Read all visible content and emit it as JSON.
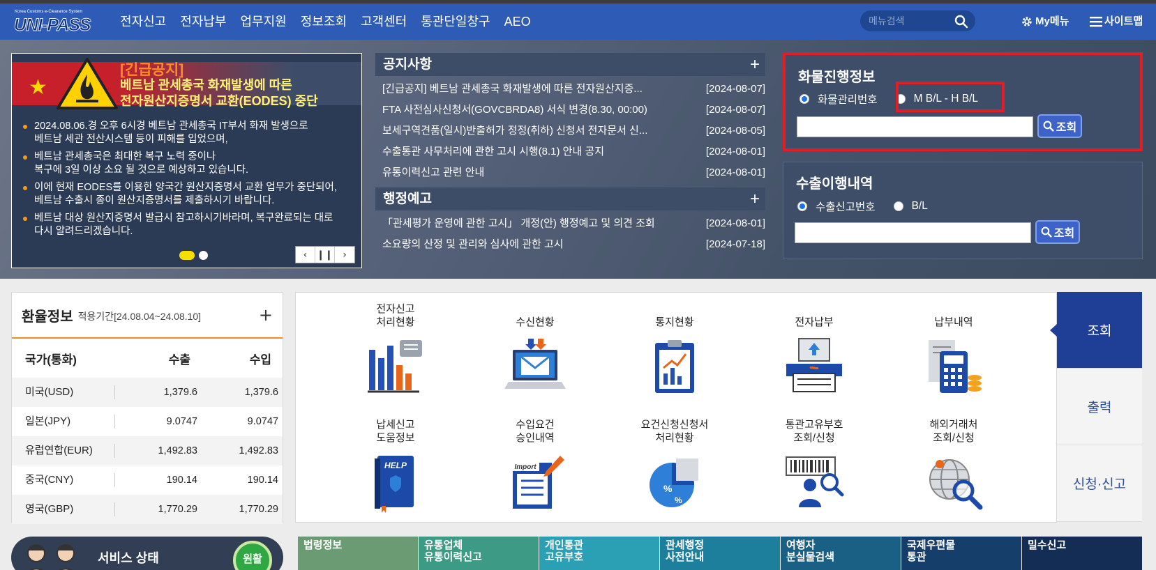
{
  "header": {
    "logo_sub": "Korea Customs e-Clearance System",
    "logo_text": "UNI-PASS",
    "nav": [
      "전자신고",
      "전자납부",
      "업무지원",
      "정보조회",
      "고객센터",
      "통관단일창구",
      "AEO"
    ],
    "search_placeholder": "메뉴검색",
    "my_menu": "My메뉴",
    "sitemap": "사이트맵"
  },
  "banner": {
    "title1": "[긴급공지]",
    "title2_line1": "베트남 관세총국 화재발생에 따른",
    "title2_line2": "전자원산지증명서 교환(EODES) 중단",
    "items": [
      "2024.08.06.경 오후 6시경 베트남 관세총국 IT부서 화재 발생으로\n베트남 세관 전산시스템 등이 피해를 입었으며,",
      "베트남 관세총국은 최대한 복구 노력 중이나\n복구에 3일 이상 소요 될 것으로 예상하고 있습니다.",
      "이에 현재 EODES를 이용한 양국간 원산지증명서 교환 업무가 중단되어,\n베트남 수출시 종이 원산지증명서를 제출하시기 바랍니다.",
      "베트남 대상 원산지증명서 발급시 참고하시기바라며, 복구완료되는 대로\n다시 알려드리겠습니다."
    ]
  },
  "notices": {
    "title": "공지사항",
    "items": [
      {
        "title": "[긴급공지] 베트남 관세총국 화재발생에 따른 전자원산지증...",
        "date": "[2024-08-07]"
      },
      {
        "title": "FTA 사전심사신청서(GOVCBRDA8) 서식 변경(8.30, 00:00)",
        "date": "[2024-08-07]"
      },
      {
        "title": "보세구역견품(일시)반출허가 정정(취하) 신청서 전자문서 신...",
        "date": "[2024-08-05]"
      },
      {
        "title": "수출통관 사무처리에 관한 고시 시행(8.1) 안내 공지",
        "date": "[2024-08-01]"
      },
      {
        "title": "유통이력신고 관련 안내",
        "date": "[2024-08-01]"
      }
    ]
  },
  "admin": {
    "title": "행정예고",
    "items": [
      {
        "title": "「관세평가 운영에 관한 고시」 개정(안) 행정예고 및 의견 조회",
        "date": "[2024-08-01]"
      },
      {
        "title": "소요량의 산정 및 관리와 심사에 관한 고시",
        "date": "[2024-07-18]"
      }
    ]
  },
  "cargo": {
    "title": "화물진행정보",
    "opt1": "화물관리번호",
    "opt2": "M B/L - H B/L",
    "btn": "조회"
  },
  "export": {
    "title": "수출이행내역",
    "opt1": "수출신고번호",
    "opt2": "B/L",
    "btn": "조회"
  },
  "rate": {
    "title": "환율정보",
    "period": "적용기간[24.08.04~24.08.10]",
    "cols": [
      "국가(통화)",
      "수출",
      "수입"
    ],
    "rows": [
      [
        "미국(USD)",
        "1,379.6",
        "1,379.6"
      ],
      [
        "일본(JPY)",
        "9.0747",
        "9.0747"
      ],
      [
        "유럽연합(EUR)",
        "1,492.83",
        "1,492.83"
      ],
      [
        "중국(CNY)",
        "190.14",
        "190.14"
      ],
      [
        "영국(GBP)",
        "1,770.29",
        "1,770.29"
      ]
    ]
  },
  "services": [
    {
      "label": "전자신고\n처리현황",
      "icon": "bar-chart-icon"
    },
    {
      "label": "수신현황",
      "icon": "laptop-mail-icon"
    },
    {
      "label": "통지현황",
      "icon": "clipboard-chart-icon"
    },
    {
      "label": "전자납부",
      "icon": "atm-payment-icon"
    },
    {
      "label": "납부내역",
      "icon": "receipt-calculator-icon"
    },
    {
      "label": "납세신고\n도움정보",
      "icon": "help-book-icon"
    },
    {
      "label": "수입요건\n승인내역",
      "icon": "import-document-icon"
    },
    {
      "label": "요건신청신청서\n처리현황",
      "icon": "percent-pie-icon"
    },
    {
      "label": "통관고유부호\n조회/신청",
      "icon": "barcode-person-icon"
    },
    {
      "label": "해외거래처\n조회/신청",
      "icon": "globe-search-icon"
    }
  ],
  "tabs": [
    "조회",
    "출력",
    "신청·신고"
  ],
  "service_status": {
    "label": "서비스 상태",
    "state": "원활"
  },
  "quick_links": [
    "법령정보",
    "유통업체\n유통이력신고",
    "개인통관\n고유부호",
    "관세행정\n사전안내",
    "여행자\n분실물검색",
    "국제우편물\n통관",
    "밀수신고"
  ],
  "colors": {
    "header": "#2d5bb5",
    "highlight": "#e11d26",
    "tab_active": "#1f3f97",
    "accent_orange": "#f08b2a"
  }
}
